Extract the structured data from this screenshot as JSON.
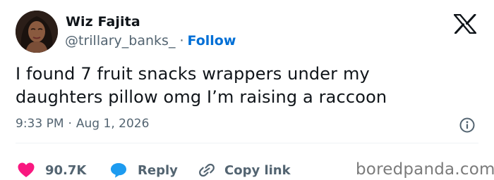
{
  "user": {
    "display_name": "Wiz Fajita",
    "handle": "@trillary_banks_",
    "separator": "·",
    "follow_label": "Follow"
  },
  "tweet": {
    "text_line1": "I found 7 fruit snacks wrappers under my",
    "text_line2": "daughters pillow omg I’m raising a raccoon",
    "time": "9:33 PM",
    "date_separator": "·",
    "date": "Aug 1, 2026"
  },
  "actions": {
    "likes_count": "90.7K",
    "reply_label": "Reply",
    "copy_label": "Copy link"
  },
  "icons": {
    "logo": "x-logo-icon",
    "info": "info-icon",
    "like": "heart-icon",
    "reply": "speech-bubble-icon",
    "copy": "link-icon"
  },
  "colors": {
    "like": "#f91880",
    "reply": "#1d9bf0",
    "follow": "#006fd6",
    "muted_text": "#536471"
  },
  "watermark": {
    "text": "boredpanda.com"
  }
}
